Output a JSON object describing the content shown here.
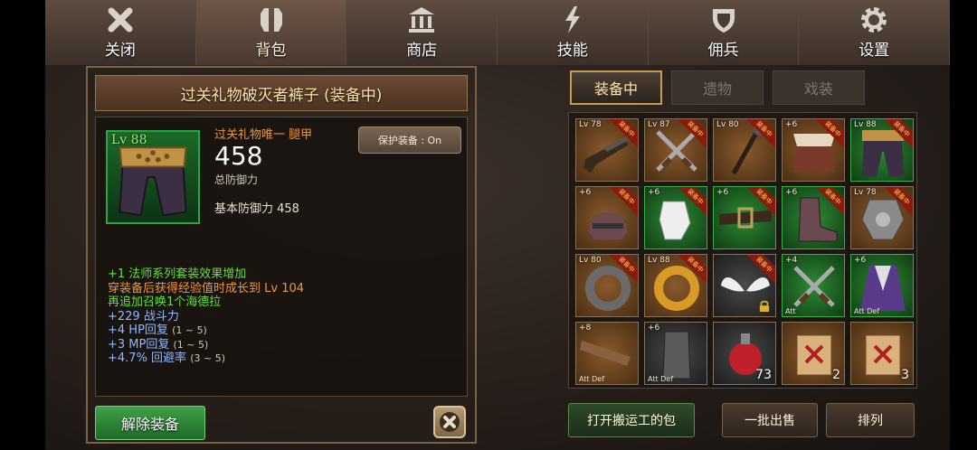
{
  "menu": {
    "tabs": [
      {
        "label": "关闭",
        "icon": "close-icon"
      },
      {
        "label": "背包",
        "icon": "armor-icon",
        "active": true
      },
      {
        "label": "商店",
        "icon": "shop-icon"
      },
      {
        "label": "技能",
        "icon": "skill-lightning-icon"
      },
      {
        "label": "佣兵",
        "icon": "shield-icon"
      },
      {
        "label": "设置",
        "icon": "gear-icon"
      }
    ]
  },
  "item": {
    "title": "过关礼物破灭者裤子 (装备中)",
    "level": "Lv 88",
    "type": "过关礼物唯一 腿甲",
    "defense": "458",
    "defense_caption": "总防御力",
    "base_defense": "基本防御力 458",
    "protect_label": "保护装备 : On",
    "effects": [
      {
        "text": "+1 法师系列套装效果增加",
        "color": "green"
      },
      {
        "text": "穿装备后获得经验值时成长到 Lv 104",
        "color": "orange"
      },
      {
        "text": "再追加召唤1个海德拉",
        "color": "green"
      },
      {
        "text": "+229 战斗力",
        "color": "blue",
        "range": ""
      },
      {
        "text": "+4 HP回复",
        "color": "blue",
        "range": "(1 ~ 5)"
      },
      {
        "text": "+3 MP回复",
        "color": "blue",
        "range": "(1 ~ 5)"
      },
      {
        "text": "+4.7% 回避率",
        "color": "blue",
        "range": "(3 ~ 5)"
      }
    ],
    "unequip_label": "解除装备"
  },
  "inventory": {
    "tabs": [
      "装备中",
      "遗物",
      "戏装"
    ],
    "equipped_tag": "装备中",
    "slots": [
      {
        "name": "shotgun-slot",
        "level": "Lv 78",
        "rarity": "brown",
        "equipped": true,
        "icon": "shotgun-icon"
      },
      {
        "name": "crossed-swords-slot",
        "level": "Lv 87",
        "rarity": "brown",
        "equipped": true,
        "icon": "crossed-swords-icon"
      },
      {
        "name": "staff-slot",
        "level": "Lv 80",
        "rarity": "brown",
        "equipped": true,
        "icon": "staff-icon"
      },
      {
        "name": "fur-armor-slot",
        "level": "+6",
        "rarity": "brown",
        "equipped": true,
        "icon": "fur-armor-icon"
      },
      {
        "name": "pants-slot",
        "level": "Lv 88",
        "rarity": "green",
        "equipped": true,
        "icon": "pants-icon"
      },
      {
        "name": "helmet-slot",
        "level": "+6",
        "rarity": "brown",
        "equipped": true,
        "icon": "helmet-icon"
      },
      {
        "name": "gloves-slot",
        "level": "+6",
        "rarity": "green",
        "equipped": true,
        "icon": "gloves-icon"
      },
      {
        "name": "belt-slot",
        "level": "+6",
        "rarity": "green",
        "equipped": true,
        "icon": "belt-icon"
      },
      {
        "name": "boots-slot",
        "level": "+6",
        "rarity": "green",
        "equipped": true,
        "icon": "boots-icon"
      },
      {
        "name": "amulet-slot",
        "level": "Lv 78",
        "rarity": "brown",
        "equipped": true,
        "icon": "amulet-icon"
      },
      {
        "name": "iron-ring-slot",
        "level": "Lv 80",
        "rarity": "brown",
        "equipped": true,
        "icon": "iron-ring-icon"
      },
      {
        "name": "gold-ring-slot",
        "level": "Lv 88",
        "rarity": "brown",
        "equipped": true,
        "icon": "gold-ring-icon"
      },
      {
        "name": "wings-slot",
        "level": "",
        "rarity": "grey",
        "equipped": true,
        "locked": true,
        "icon": "wings-icon"
      },
      {
        "name": "dark-swords-slot",
        "level": "+4",
        "rarity": "green",
        "equipped": false,
        "tags": "Att",
        "icon": "crossed-swords-icon"
      },
      {
        "name": "cloak-slot",
        "level": "+6",
        "rarity": "green",
        "equipped": false,
        "tags": "Att  Def",
        "icon": "cloak-icon"
      },
      {
        "name": "wooden-club-slot",
        "level": "+8",
        "rarity": "brown",
        "equipped": false,
        "tags": "Att  Def",
        "icon": "club-icon"
      },
      {
        "name": "leg-armor-slot",
        "level": "+6",
        "rarity": "grey",
        "equipped": false,
        "tags": "Att  Def",
        "icon": "leg-armor-icon"
      },
      {
        "name": "potion-slot",
        "level": "",
        "rarity": "grey",
        "equipped": false,
        "count": "73",
        "icon": "potion-icon"
      },
      {
        "name": "scroll-red-slot",
        "level": "",
        "rarity": "brown",
        "equipped": false,
        "count": "2",
        "icon": "scroll-icon"
      },
      {
        "name": "scroll-red2-slot",
        "level": "",
        "rarity": "brown",
        "equipped": false,
        "count": "3",
        "icon": "scroll-icon"
      }
    ],
    "porter_label": "打开搬运工的包",
    "bulk_sell_label": "一批出售",
    "sort_label": "排列"
  },
  "colors": {
    "accent": "#c89a52",
    "equipped_ribbon": "#8a1a0a",
    "green_text": "#63e03c",
    "orange_text": "#f0963a",
    "blue_text": "#8fb7ff"
  }
}
